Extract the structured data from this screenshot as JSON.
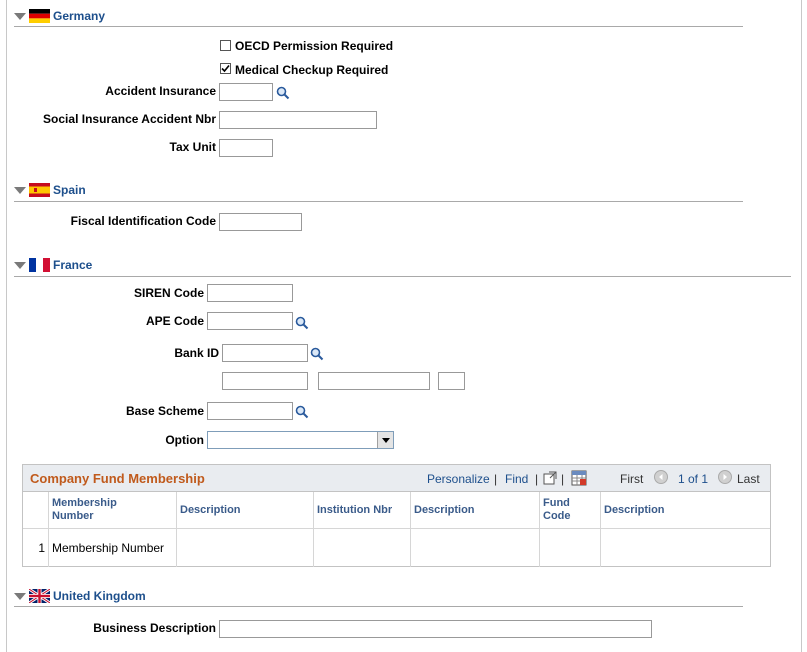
{
  "germany": {
    "title": "Germany",
    "oecd_label": "OECD Permission Required",
    "oecd_checked": false,
    "medical_label": "Medical Checkup Required",
    "medical_checked": true,
    "accident_insurance_label": "Accident Insurance",
    "accident_insurance_value": "",
    "social_insurance_label": "Social Insurance Accident Nbr",
    "social_insurance_value": "",
    "tax_unit_label": "Tax Unit",
    "tax_unit_value": ""
  },
  "spain": {
    "title": "Spain",
    "fiscal_label": "Fiscal Identification Code",
    "fiscal_value": ""
  },
  "france": {
    "title": "France",
    "siren_label": "SIREN Code",
    "siren_value": "",
    "ape_label": "APE Code",
    "ape_value": "",
    "bank_label": "Bank ID",
    "bank_value": "",
    "base_scheme_label": "Base Scheme",
    "base_scheme_value": "",
    "option_label": "Option",
    "option_value": ""
  },
  "fund_grid": {
    "title": "Company Fund Membership",
    "personalize": "Personalize",
    "find": "Find",
    "separator": "|",
    "first": "First",
    "range": "1 of 1",
    "last": "Last",
    "columns": {
      "membership_number_1": "Membership",
      "membership_number_2": "Number",
      "description_1": "Description",
      "institution_nbr": "Institution Nbr",
      "description_2": "Description",
      "fund_code_1": "Fund",
      "fund_code_2": "Code",
      "description_3": "Description"
    },
    "rows": [
      {
        "index": "1",
        "membership_number": "Membership Number"
      }
    ]
  },
  "uk": {
    "title": "United Kingdom",
    "business_label": "Business Description",
    "business_value": ""
  },
  "colors": {
    "section_title": "#1d4f8c",
    "grid_title": "#c05a1c",
    "grid_header_bg": "#e9ecf0"
  }
}
